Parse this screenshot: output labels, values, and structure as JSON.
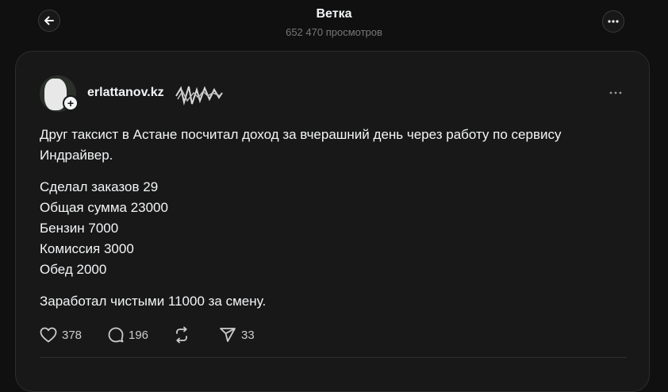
{
  "header": {
    "title": "Ветка",
    "views": "652 470 просмотров",
    "back_icon": "arrow-left-icon",
    "more_icon": "more-horizontal-icon"
  },
  "post": {
    "username": "erlattanov.kz",
    "paragraphs": {
      "intro": "Друг таксист в Астане посчитал доход за вчерашний день через работу по сервису Индрайвер.",
      "lines": [
        "Сделал заказов 29",
        "Общая сумма 23000",
        "Бензин 7000",
        "Комиссия 3000",
        "Обед 2000"
      ],
      "outro": "Заработал чистыми 11000 за смену."
    },
    "actions": {
      "likes": "378",
      "replies": "196",
      "shares": "33"
    }
  },
  "colors": {
    "background": "#101010",
    "card": "#181818",
    "text": "#f3f5f7",
    "muted": "#777777"
  }
}
